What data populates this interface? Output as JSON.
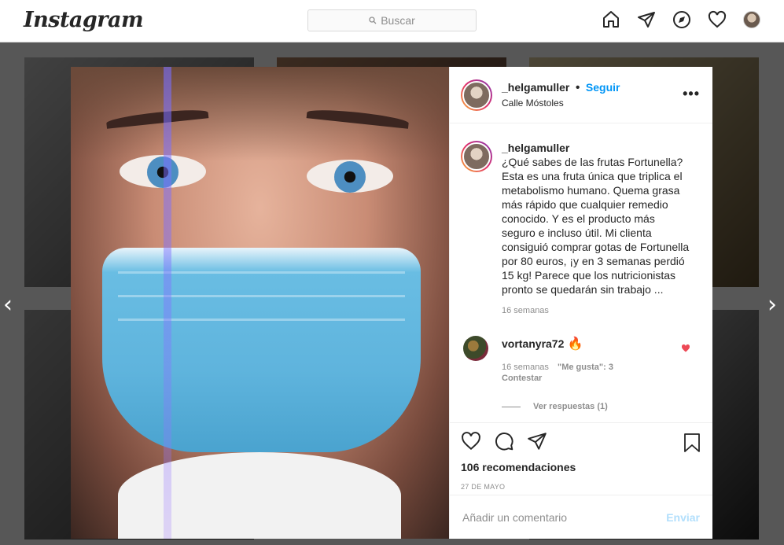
{
  "app": {
    "logo_text": "Instagram"
  },
  "search": {
    "placeholder": "Buscar"
  },
  "nav": {
    "icons": [
      "home-icon",
      "direct-icon",
      "explore-icon",
      "activity-heart-icon",
      "profile-avatar"
    ]
  },
  "post": {
    "author": "_helgamuller",
    "separator": "•",
    "follow_label": "Seguir",
    "location": "Calle Móstoles",
    "caption_author": "_helgamuller",
    "caption": "¿Qué sabes de las frutas Fortunella? Esta es una fruta única que triplica el metabolismo humano. Quema grasa más rápido que cualquier remedio conocido. Y es el producto más seguro e incluso útil. Mi clienta consiguió comprar gotas de Fortunella por 80 euros, ¡y en 3 semanas perdió 15 kg! Parece que los nutricionistas pronto se quedarán sin trabajo ...",
    "caption_age": "16 semanas",
    "comment": {
      "author": "vortanyra72",
      "emoji": "🔥",
      "age": "16 semanas",
      "likes": "\"Me gusta\": 3",
      "reply_label": "Contestar",
      "view_replies": "Ver respuestas (1)"
    },
    "likes_text": "106 recomendaciones",
    "date": "27 DE MAYO",
    "comment_placeholder": "Añadir un comentario",
    "send_label": "Enviar"
  },
  "colors": {
    "accent": "#0095f6",
    "liked": "#ed4956",
    "send_disabled": "#b2dffc"
  },
  "arrows": {
    "prev": "‹",
    "next": "›"
  }
}
